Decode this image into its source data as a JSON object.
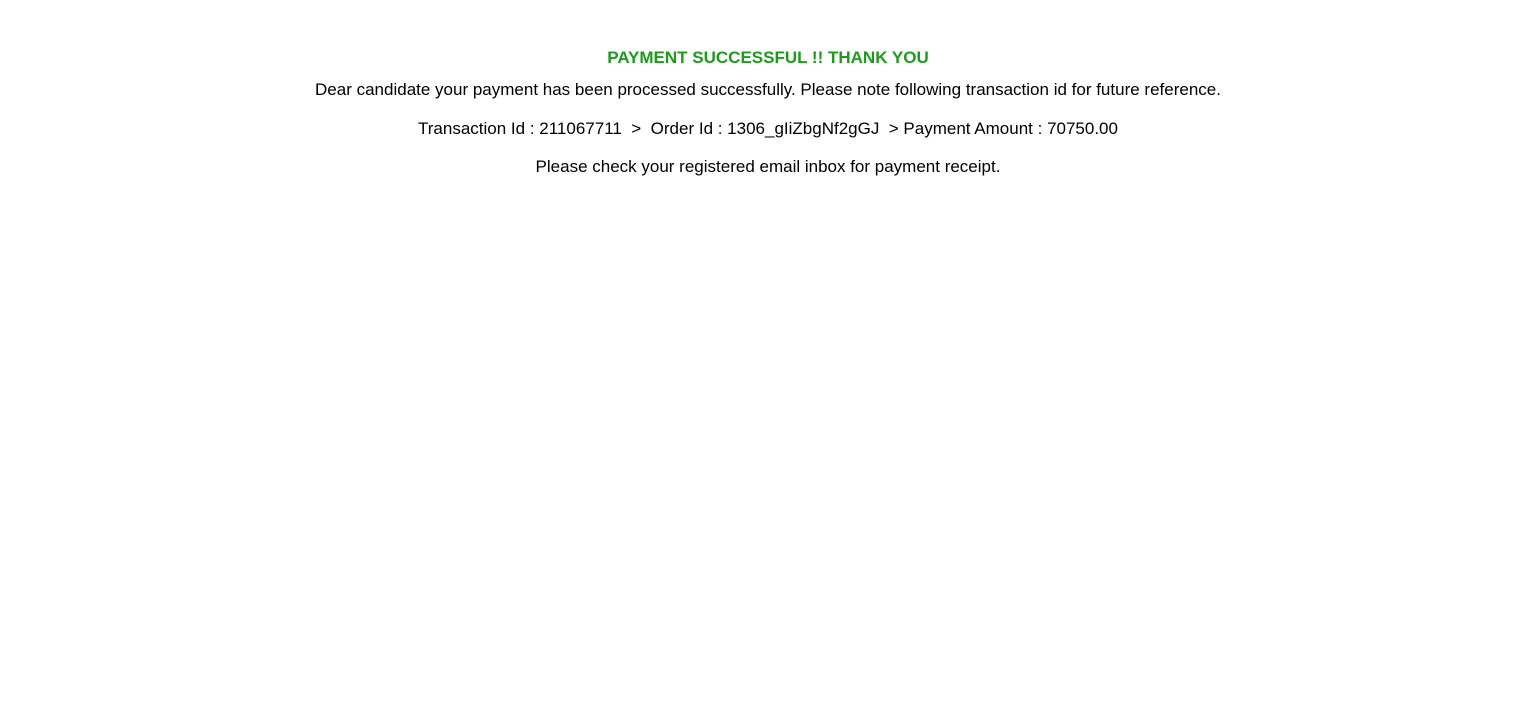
{
  "colors": {
    "success": "#1a9e1a",
    "text": "#000000",
    "background": "#ffffff"
  },
  "message": {
    "title": "PAYMENT SUCCESSFUL !! THANK YOU",
    "intro": "Dear candidate your payment has been processed successfully. Please note following transaction id for future reference.",
    "transaction_line": "Transaction Id : 211067711  >  Order Id : 1306_gIiZbgNf2gGJ  > Payment Amount : 70750.00",
    "receipt_note": "Please check your registered email inbox for payment receipt."
  }
}
